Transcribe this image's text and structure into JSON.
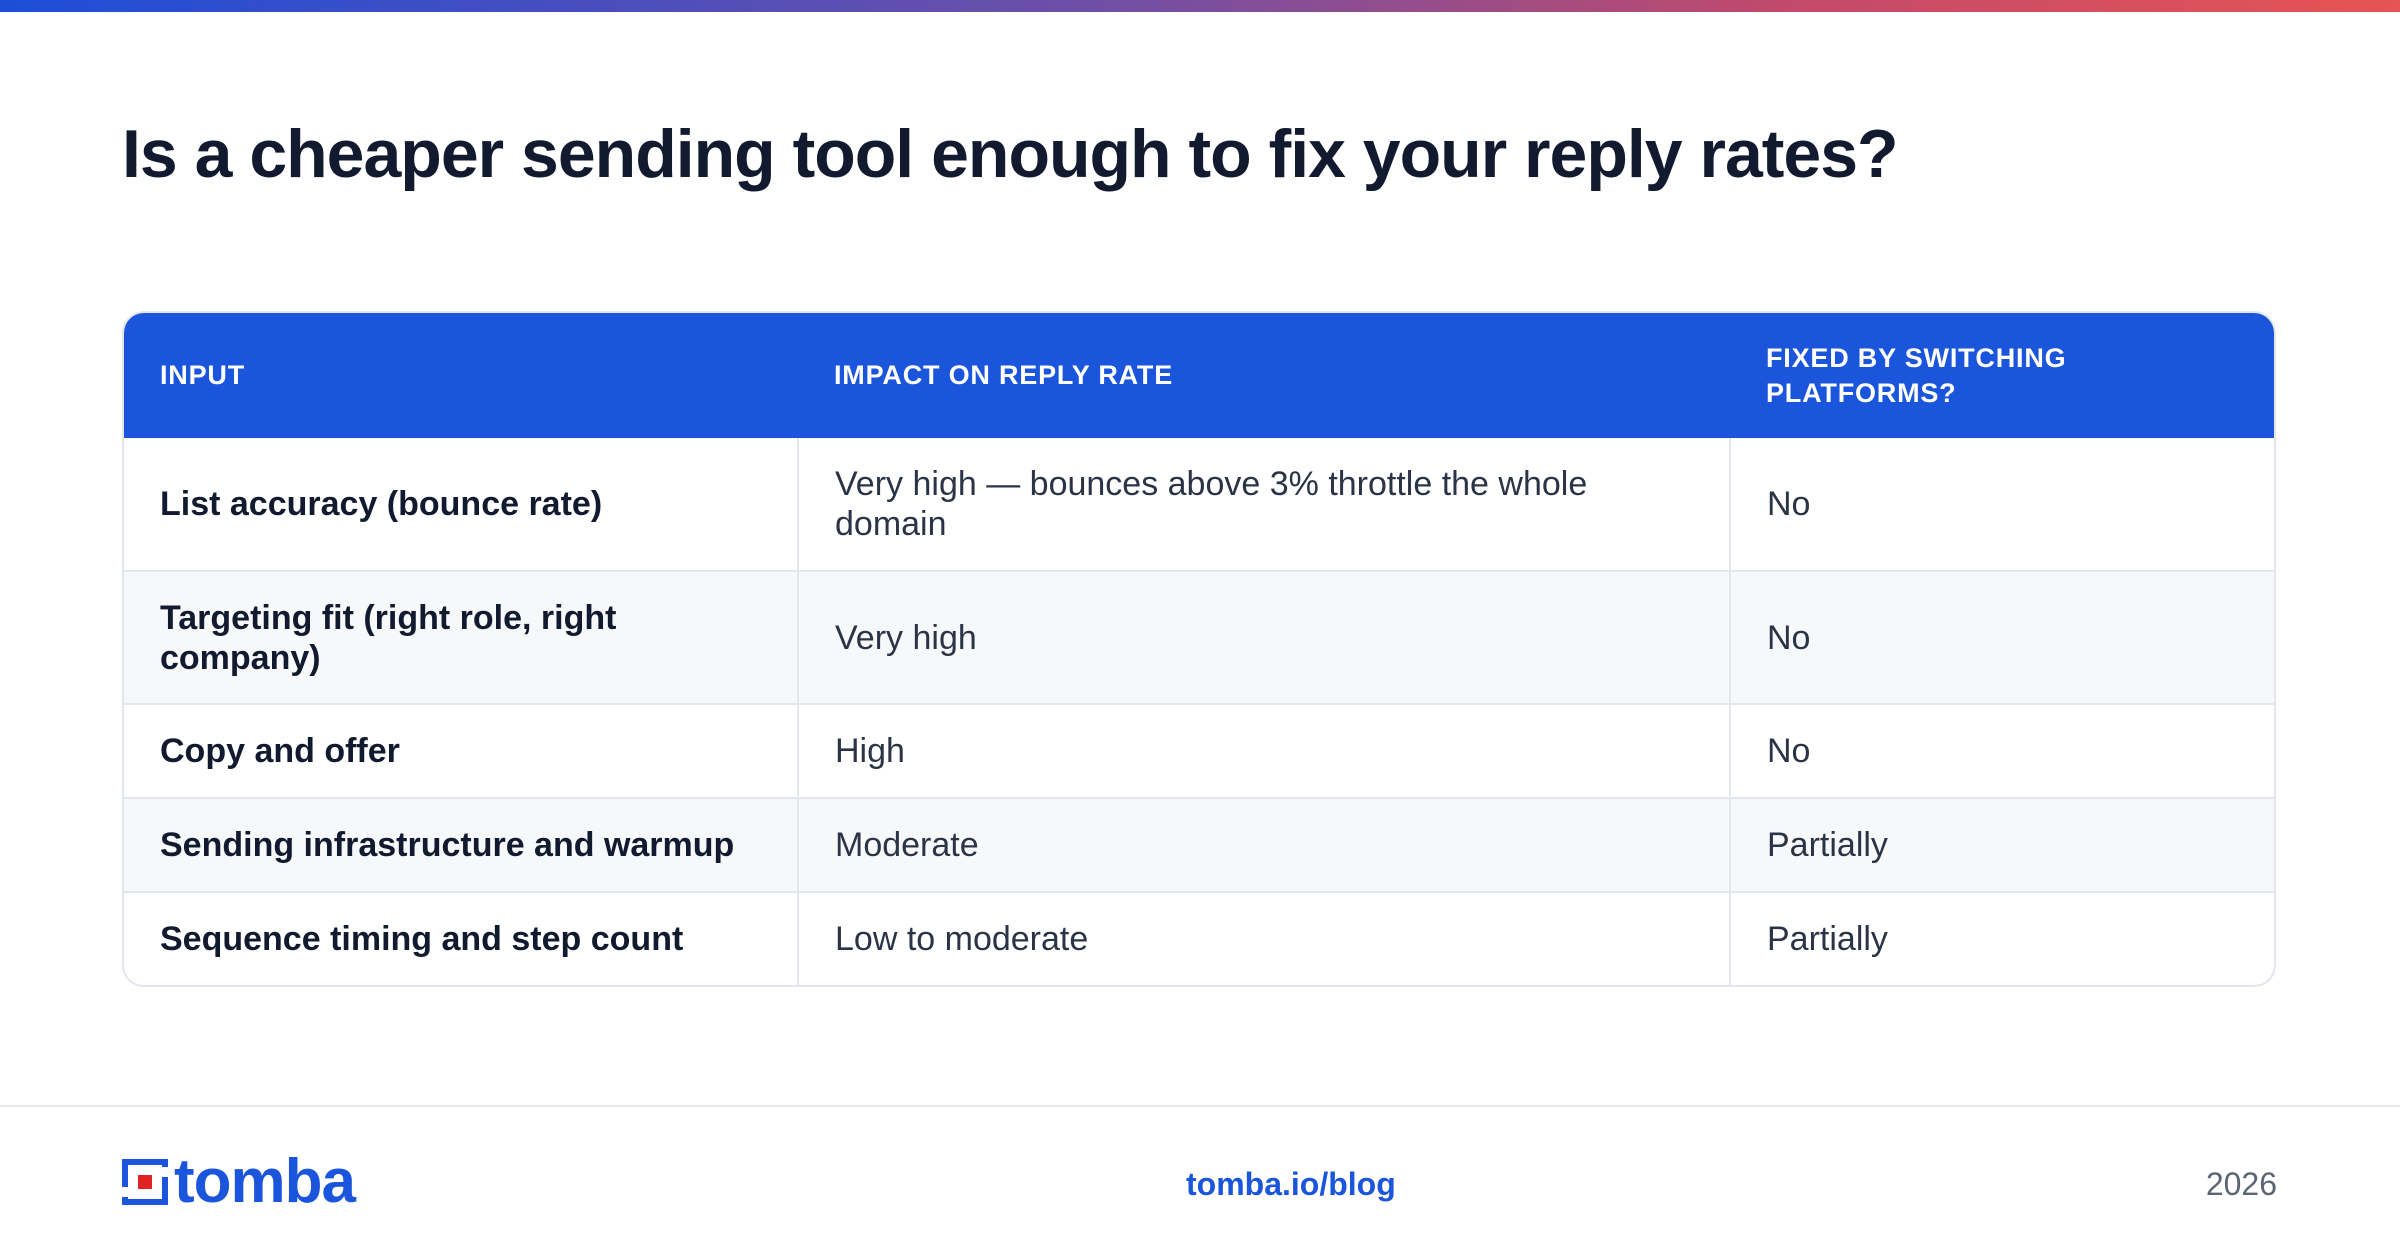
{
  "title": "Is a cheaper sending tool enough to fix your reply rates?",
  "table": {
    "headers": [
      "INPUT",
      "IMPACT ON REPLY RATE",
      "FIXED BY SWITCHING PLATFORMS?"
    ],
    "rows": [
      [
        "List accuracy (bounce rate)",
        "Very high — bounces above 3% throttle the whole domain",
        "No"
      ],
      [
        "Targeting fit (right role, right company)",
        "Very high",
        "No"
      ],
      [
        "Copy and offer",
        "High",
        "No"
      ],
      [
        "Sending infrastructure and warmup",
        "Moderate",
        "Partially"
      ],
      [
        "Sequence timing and step count",
        "Low to moderate",
        "Partially"
      ]
    ]
  },
  "footer": {
    "logo_text": "tomba",
    "url": "tomba.io/blog",
    "year": "2026"
  },
  "colors": {
    "brand_blue": "#1a55dc",
    "accent_red": "#e02424",
    "title_text": "#111a2e"
  },
  "icons": {
    "logo": "tomba-logo-icon"
  }
}
